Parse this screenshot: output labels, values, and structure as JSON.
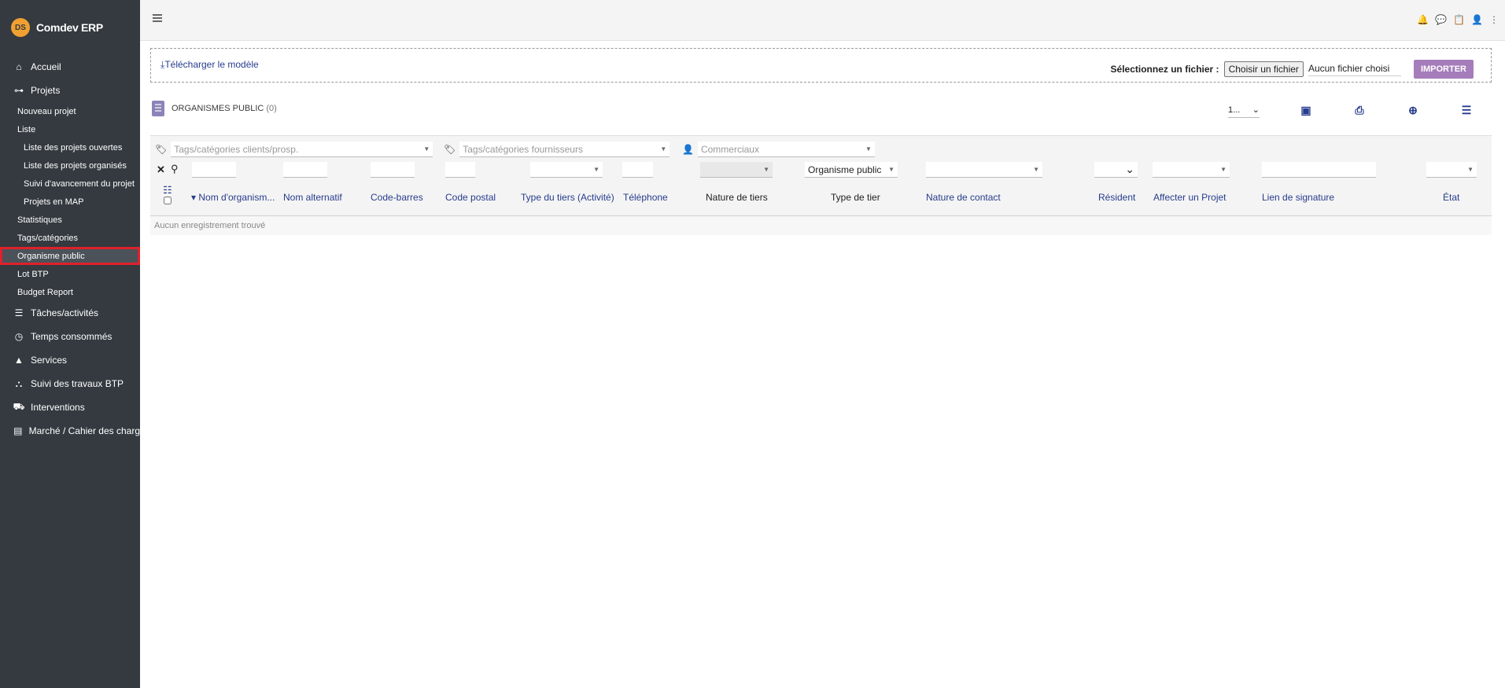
{
  "app": {
    "logo_text": "DS",
    "name": "Comdev ERP"
  },
  "sidebar": {
    "main1": [
      {
        "label": "Accueil",
        "icon": "home-icon",
        "glyph": "⌂"
      },
      {
        "label": "Projets",
        "icon": "sitemap-icon",
        "glyph": "⊶"
      }
    ],
    "sub": [
      {
        "label": "Nouveau projet",
        "deep": false
      },
      {
        "label": "Liste",
        "deep": false
      },
      {
        "label": "Liste des projets ouvertes",
        "deep": true
      },
      {
        "label": "Liste des projets organisés",
        "deep": true
      },
      {
        "label": "Suivi d'avancement du projet",
        "deep": true
      },
      {
        "label": "Projets en MAP",
        "deep": true
      },
      {
        "label": "Statistiques",
        "deep": false
      },
      {
        "label": "Tags/catégories",
        "deep": false
      },
      {
        "label": "Organisme public",
        "deep": false,
        "active": true
      },
      {
        "label": "Lot BTP",
        "deep": false
      },
      {
        "label": "Budget Report",
        "deep": false
      }
    ],
    "main2": [
      {
        "label": "Tâches/activités",
        "icon": "tasks-icon",
        "glyph": "☰"
      },
      {
        "label": "Temps consommés",
        "icon": "clock-icon",
        "glyph": "◷"
      },
      {
        "label": "Services",
        "icon": "services-icon",
        "glyph": "▲"
      },
      {
        "label": "Suivi des travaux BTP",
        "icon": "binoculars-icon",
        "glyph": "⛬"
      },
      {
        "label": "Interventions",
        "icon": "truck-icon",
        "glyph": "⛟"
      },
      {
        "label": "Marché / Cahier des charg",
        "icon": "book-icon",
        "glyph": "▤"
      }
    ]
  },
  "topbar": {
    "icons": [
      "bell-icon",
      "chat-icon",
      "clipboard-icon",
      "user-icon",
      "more-vertical-icon"
    ]
  },
  "import": {
    "download_label": "Télécharger le modèle",
    "select_label": "Sélectionnez un fichier :",
    "choose_button": "Choisir un fichier",
    "no_file": "Aucun fichier choisi",
    "import_button": "IMPORTER"
  },
  "list": {
    "title": "ORGANISMES PUBLIC",
    "count": "(0)",
    "limit": "1..."
  },
  "filters": {
    "tags_clients_placeholder": "Tags/catégories clients/prosp.",
    "tags_fournisseurs_placeholder": "Tags/catégories fournisseurs",
    "commerciaux_placeholder": "Commerciaux",
    "type_tier_value": "Organisme public"
  },
  "columns": [
    "Nom d'organism...",
    "Nom alternatif",
    "Code-barres",
    "Code postal",
    "Type du tiers (Activité)",
    "Téléphone",
    "Nature de tiers",
    "Type de tier",
    "Nature de contact",
    "Résident",
    "Affecter un Projet",
    "Lien de signature",
    "État"
  ],
  "empty_message": "Aucun enregistrement trouvé"
}
